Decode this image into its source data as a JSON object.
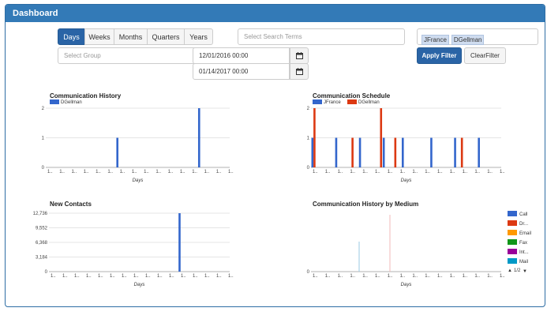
{
  "header": {
    "title": "Dashboard"
  },
  "period_tabs": [
    "Days",
    "Weeks",
    "Months",
    "Quarters",
    "Years"
  ],
  "active_tab": "Days",
  "search": {
    "placeholder": "Select Search Terms"
  },
  "group": {
    "placeholder": "Select Group"
  },
  "dates": {
    "start": "12/01/2016 00:00",
    "end": "01/14/2017 00:00"
  },
  "selected_users": [
    "JFrance",
    "DGellman"
  ],
  "buttons": {
    "apply": "Apply Filter",
    "clear": "ClearFilter"
  },
  "colors": {
    "blue": "#3366cc",
    "red": "#dc3912",
    "orange": "#ff9900",
    "green": "#109618",
    "purple": "#990099",
    "teal": "#0099c6"
  },
  "chart_data": [
    {
      "type": "bar",
      "title": "Communication History",
      "xlabel": "Days",
      "ylim": [
        0,
        2
      ],
      "yticks": [
        "0",
        "1",
        "2"
      ],
      "x_count": 24,
      "series": [
        {
          "name": "DGellman",
          "color": "#3366cc",
          "values": [
            0,
            0,
            0,
            0,
            0,
            0,
            0,
            0,
            0,
            0,
            0,
            0,
            0,
            0,
            0,
            0,
            0,
            1,
            0,
            0,
            0,
            0,
            0,
            0,
            0,
            0,
            0,
            0,
            0,
            0,
            0,
            0,
            0,
            0,
            0,
            0,
            0,
            2,
            0,
            0,
            0,
            0,
            0,
            0,
            0
          ]
        }
      ]
    },
    {
      "type": "bar",
      "title": "Communication Schedule",
      "xlabel": "Days",
      "ylim": [
        0,
        2
      ],
      "yticks": [
        "0",
        "1",
        "2"
      ],
      "series": [
        {
          "name": "JFrance",
          "color": "#3366cc",
          "values": [
            1,
            0,
            0,
            0,
            0,
            1,
            0,
            0,
            0,
            0,
            1,
            0,
            0,
            0,
            0,
            1,
            0,
            0,
            0,
            1,
            0,
            0,
            0,
            0,
            0,
            1,
            0,
            0,
            0,
            0,
            1,
            0,
            0,
            0,
            0,
            1,
            0,
            0,
            0,
            0
          ]
        },
        {
          "name": "DGellman",
          "color": "#dc3912",
          "values": [
            2,
            0,
            0,
            0,
            0,
            0,
            0,
            0,
            1,
            0,
            0,
            0,
            0,
            0,
            2,
            0,
            0,
            1,
            0,
            0,
            0,
            0,
            0,
            0,
            0,
            0,
            0,
            0,
            0,
            0,
            0,
            1,
            0,
            0,
            0,
            0,
            0,
            0,
            0,
            0
          ]
        }
      ]
    },
    {
      "type": "bar",
      "title": "New Contacts",
      "xlabel": "Days",
      "ylim": [
        0,
        12736
      ],
      "yticks": [
        "0",
        "3,184",
        "6,368",
        "9,552",
        "12,736"
      ],
      "series": [
        {
          "name": "",
          "color": "#3366cc",
          "values": [
            0,
            0,
            0,
            0,
            0,
            0,
            0,
            0,
            0,
            0,
            0,
            0,
            0,
            0,
            0,
            0,
            0,
            0,
            0,
            0,
            0,
            0,
            0,
            0,
            0,
            0,
            0,
            0,
            0,
            0,
            0,
            0,
            12736,
            0,
            0,
            0,
            0,
            0,
            0,
            0,
            0,
            0,
            0,
            0,
            0
          ]
        }
      ]
    },
    {
      "type": "bar",
      "title": "Communication History by Medium",
      "xlabel": "Days",
      "yticks": [
        "0"
      ],
      "legend": [
        "Call",
        "Dr...",
        "Email",
        "Fax",
        "Int...",
        "Mail"
      ],
      "legend_colors": [
        "#3366cc",
        "#dc3912",
        "#ff9900",
        "#109618",
        "#990099",
        "#0099c6"
      ],
      "pager": "1/2"
    }
  ]
}
